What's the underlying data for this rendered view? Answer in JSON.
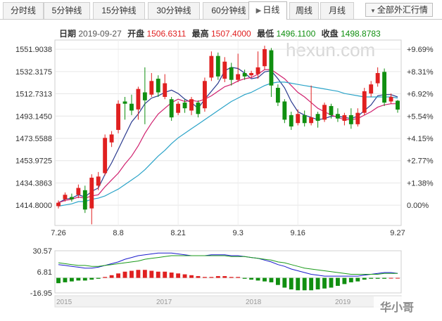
{
  "tabs": [
    {
      "label": "分时线",
      "active": false
    },
    {
      "label": "5分钟线",
      "active": false
    },
    {
      "label": "15分钟线",
      "active": false
    },
    {
      "label": "30分钟线",
      "active": false
    },
    {
      "label": "60分钟线",
      "active": false
    },
    {
      "label": "日线",
      "active": true
    },
    {
      "label": "周线",
      "active": false
    },
    {
      "label": "月线",
      "active": false
    }
  ],
  "market_button": {
    "label": "全部外汇行情"
  },
  "info": {
    "date_label": "日期",
    "date": "2019-09-27",
    "open_label": "开盘",
    "open": "1506.6311",
    "high_label": "最高",
    "high": "1507.4000",
    "low_label": "最低",
    "low": "1496.1100",
    "close_label": "收盘",
    "close": "1498.8783"
  },
  "watermark": "hexun.com",
  "corner_logo": "华小哥",
  "colors": {
    "up": "#e02020",
    "down": "#108f10",
    "ma5": "#2a3a8f",
    "ma10": "#d0206e",
    "ma20": "#2aa3c8",
    "macd_dif": "#1a1acc",
    "macd_dea": "#1a9a1a"
  },
  "chart_data": [
    {
      "type": "candlestick",
      "y_ticks": [
        "1551.9038",
        "1532.3175",
        "1512.7313",
        "1493.1450",
        "1473.5588",
        "1453.9725",
        "1434.3863",
        "1414.8000"
      ],
      "y_ticks_pct": [
        "+9.69%",
        "+8.31%",
        "+6.92%",
        "+5.54%",
        "+4.15%",
        "+2.77%",
        "+1.38%",
        "0.00%"
      ],
      "x_ticks": [
        "7.26",
        "8.8",
        "8.21",
        "9.3",
        "9.16",
        "9.27"
      ],
      "ylim": [
        1397,
        1560
      ],
      "candles": [
        {
          "o": 1414,
          "c": 1417,
          "h": 1419,
          "l": 1412
        },
        {
          "o": 1420,
          "c": 1424,
          "h": 1426,
          "l": 1418
        },
        {
          "o": 1422,
          "c": 1420,
          "h": 1425,
          "l": 1418
        },
        {
          "o": 1424,
          "c": 1430,
          "h": 1433,
          "l": 1421
        },
        {
          "o": 1428,
          "c": 1411,
          "h": 1432,
          "l": 1408
        },
        {
          "o": 1412,
          "c": 1439,
          "h": 1442,
          "l": 1398
        },
        {
          "o": 1432,
          "c": 1440,
          "h": 1444,
          "l": 1428
        },
        {
          "o": 1443,
          "c": 1474,
          "h": 1477,
          "l": 1441
        },
        {
          "o": 1470,
          "c": 1477,
          "h": 1480,
          "l": 1466
        },
        {
          "o": 1481,
          "c": 1504,
          "h": 1507,
          "l": 1478
        },
        {
          "o": 1506,
          "c": 1504,
          "h": 1510,
          "l": 1490
        },
        {
          "o": 1504,
          "c": 1498,
          "h": 1512,
          "l": 1494
        },
        {
          "o": 1499,
          "c": 1517,
          "h": 1519,
          "l": 1490
        },
        {
          "o": 1514,
          "c": 1507,
          "h": 1536,
          "l": 1486
        },
        {
          "o": 1512,
          "c": 1524,
          "h": 1531,
          "l": 1510
        },
        {
          "o": 1526,
          "c": 1514,
          "h": 1529,
          "l": 1510
        },
        {
          "o": 1510,
          "c": 1522,
          "h": 1530,
          "l": 1508
        },
        {
          "o": 1508,
          "c": 1492,
          "h": 1510,
          "l": 1489
        },
        {
          "o": 1496,
          "c": 1504,
          "h": 1506,
          "l": 1494
        },
        {
          "o": 1505,
          "c": 1500,
          "h": 1508,
          "l": 1496
        },
        {
          "o": 1498,
          "c": 1508,
          "h": 1510,
          "l": 1494
        },
        {
          "o": 1505,
          "c": 1495,
          "h": 1507,
          "l": 1492
        },
        {
          "o": 1500,
          "c": 1524,
          "h": 1527,
          "l": 1497
        },
        {
          "o": 1527,
          "c": 1546,
          "h": 1550,
          "l": 1524
        },
        {
          "o": 1546,
          "c": 1528,
          "h": 1549,
          "l": 1525
        },
        {
          "o": 1526,
          "c": 1541,
          "h": 1545,
          "l": 1523
        },
        {
          "o": 1536,
          "c": 1525,
          "h": 1540,
          "l": 1520
        },
        {
          "o": 1525,
          "c": 1530,
          "h": 1548,
          "l": 1523
        },
        {
          "o": 1531,
          "c": 1528,
          "h": 1534,
          "l": 1525
        },
        {
          "o": 1529,
          "c": 1531,
          "h": 1533,
          "l": 1527
        },
        {
          "o": 1530,
          "c": 1536,
          "h": 1550,
          "l": 1526
        },
        {
          "o": 1537,
          "c": 1552,
          "h": 1555,
          "l": 1534
        },
        {
          "o": 1551,
          "c": 1520,
          "h": 1553,
          "l": 1510
        },
        {
          "o": 1518,
          "c": 1505,
          "h": 1521,
          "l": 1502
        },
        {
          "o": 1506,
          "c": 1490,
          "h": 1508,
          "l": 1487
        },
        {
          "o": 1494,
          "c": 1484,
          "h": 1497,
          "l": 1481
        },
        {
          "o": 1487,
          "c": 1495,
          "h": 1499,
          "l": 1485
        },
        {
          "o": 1494,
          "c": 1487,
          "h": 1498,
          "l": 1484
        },
        {
          "o": 1487,
          "c": 1492,
          "h": 1520,
          "l": 1485
        },
        {
          "o": 1495,
          "c": 1489,
          "h": 1497,
          "l": 1483
        },
        {
          "o": 1490,
          "c": 1503,
          "h": 1505,
          "l": 1488
        },
        {
          "o": 1502,
          "c": 1494,
          "h": 1504,
          "l": 1491
        },
        {
          "o": 1495,
          "c": 1491,
          "h": 1500,
          "l": 1488
        },
        {
          "o": 1489,
          "c": 1494,
          "h": 1496,
          "l": 1485
        },
        {
          "o": 1494,
          "c": 1486,
          "h": 1500,
          "l": 1482
        },
        {
          "o": 1486,
          "c": 1496,
          "h": 1500,
          "l": 1484
        },
        {
          "o": 1496,
          "c": 1515,
          "h": 1518,
          "l": 1494
        },
        {
          "o": 1513,
          "c": 1521,
          "h": 1524,
          "l": 1510
        },
        {
          "o": 1522,
          "c": 1531,
          "h": 1536,
          "l": 1519
        },
        {
          "o": 1532,
          "c": 1505,
          "h": 1535,
          "l": 1502
        },
        {
          "o": 1506,
          "c": 1510,
          "h": 1513,
          "l": 1504
        },
        {
          "o": 1506.6311,
          "c": 1498.8783,
          "h": 1507.4,
          "l": 1496.11
        }
      ],
      "ma": [
        {
          "name": "MA5",
          "color": "#2a3a8f",
          "values": [
            1417,
            1420,
            1421,
            1424,
            1422,
            1427,
            1430,
            1442,
            1452,
            1464,
            1476,
            1488,
            1495,
            1504,
            1509,
            1511,
            1514,
            1516,
            1513,
            1508,
            1505,
            1500,
            1508,
            1515,
            1522,
            1533,
            1536,
            1535,
            1531,
            1526,
            1527,
            1532,
            1533,
            1526,
            1518,
            1506,
            1497,
            1494,
            1492,
            1490,
            1491,
            1493,
            1493,
            1492,
            1491,
            1493,
            1498,
            1503,
            1511,
            1512,
            1512,
            1510
          ]
        },
        {
          "name": "MA10",
          "color": "#d0206e",
          "values": [
            1417,
            1419,
            1420,
            1422,
            1421,
            1423,
            1424,
            1431,
            1437,
            1443,
            1451,
            1458,
            1467,
            1478,
            1487,
            1495,
            1500,
            1505,
            1508,
            1506,
            1507,
            1506,
            1508,
            1511,
            1515,
            1519,
            1521,
            1524,
            1526,
            1527,
            1530,
            1534,
            1534,
            1530,
            1526,
            1520,
            1514,
            1510,
            1505,
            1500,
            1497,
            1494,
            1492,
            1490,
            1490,
            1491,
            1494,
            1497,
            1501,
            1503,
            1504,
            1504
          ]
        },
        {
          "name": "MA20",
          "color": "#2aa3c8",
          "values": [
            1414,
            1415,
            1416,
            1418,
            1418,
            1420,
            1421,
            1423,
            1426,
            1429,
            1433,
            1437,
            1441,
            1446,
            1452,
            1458,
            1463,
            1469,
            1474,
            1478,
            1482,
            1486,
            1490,
            1494,
            1498,
            1502,
            1506,
            1509,
            1512,
            1514,
            1517,
            1520,
            1522,
            1523,
            1523,
            1522,
            1521,
            1520,
            1519,
            1518,
            1517,
            1516,
            1515,
            1513,
            1512,
            1511,
            1510,
            1510,
            1510,
            1510,
            1510,
            1509
          ]
        }
      ]
    },
    {
      "type": "macd",
      "y_ticks": [
        "30.57",
        "6.81",
        "-16.95"
      ],
      "ylim": [
        -16.95,
        30.57
      ],
      "x_years": [
        "2015",
        "2017",
        "2018",
        "2019"
      ],
      "hist": [
        -6,
        -5,
        -4,
        -3,
        -3,
        -2,
        -1,
        1,
        3,
        5,
        7,
        8,
        9,
        9,
        8,
        7,
        7,
        6,
        5,
        4,
        3,
        2,
        1,
        1,
        2,
        2,
        1,
        1,
        -1,
        -2,
        -3,
        -4,
        -5,
        -8,
        -11,
        -13,
        -14,
        -14,
        -14,
        -13,
        -12,
        -11,
        -9,
        -7,
        -5,
        -4,
        -2,
        -1,
        -1,
        -1,
        0,
        0
      ],
      "dif": [
        15,
        14,
        13,
        12,
        11,
        11,
        12,
        14,
        16,
        18,
        21,
        23,
        25,
        26,
        27,
        28,
        28,
        28,
        27,
        26,
        25,
        25,
        25,
        26,
        26,
        26,
        25,
        25,
        24,
        23,
        22,
        20,
        18,
        15,
        13,
        10,
        8,
        6,
        4,
        3,
        2,
        2,
        2,
        2,
        2,
        2,
        3,
        4,
        5,
        6,
        6,
        5
      ],
      "dea": [
        17,
        16,
        15,
        14,
        14,
        13,
        13,
        14,
        15,
        16,
        17,
        18,
        19,
        21,
        22,
        23,
        24,
        25,
        25,
        25,
        25,
        25,
        25,
        25,
        25,
        25,
        24,
        24,
        24,
        23,
        22,
        21,
        20,
        18,
        17,
        15,
        13,
        11,
        10,
        9,
        8,
        7,
        6,
        5,
        4,
        4,
        4,
        4,
        4,
        5,
        5,
        5
      ]
    }
  ]
}
